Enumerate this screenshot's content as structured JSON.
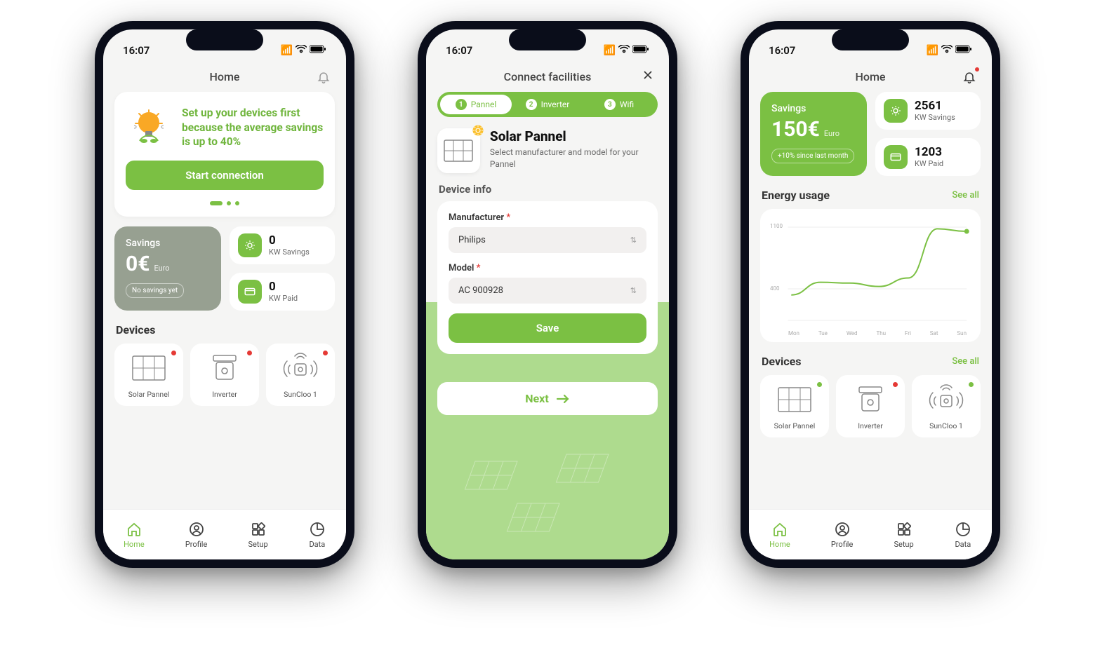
{
  "status": {
    "time": "16:07"
  },
  "screen1": {
    "header": "Home",
    "setup_text": "Set up your devices first because the average savings is up to 40%",
    "start_btn": "Start connection",
    "savings_label": "Savings",
    "savings_value": "0€",
    "savings_currency": "Euro",
    "savings_pill": "No savings yet",
    "kw_savings_num": "0",
    "kw_savings_lbl": "KW Savings",
    "kw_paid_num": "0",
    "kw_paid_lbl": "KW Paid",
    "devices_title": "Devices",
    "devices": [
      {
        "name": "Solar Pannel",
        "status": "red"
      },
      {
        "name": "Inverter",
        "status": "red"
      },
      {
        "name": "SunCloo 1",
        "status": "red"
      }
    ]
  },
  "screen2": {
    "header": "Connect facilities",
    "steps": [
      {
        "num": "1",
        "label": "Pannel",
        "active": true
      },
      {
        "num": "2",
        "label": "Inverter",
        "active": false
      },
      {
        "num": "3",
        "label": "Wifi",
        "active": false
      }
    ],
    "panel_title": "Solar Pannel",
    "panel_sub": "Select manufacturer and model for your Pannel",
    "device_info_title": "Device info",
    "manufacturer_label": "Manufacturer",
    "manufacturer_value": "Philips",
    "model_label": "Model",
    "model_value": "AC 900928",
    "save_btn": "Save",
    "next_btn": "Next"
  },
  "screen3": {
    "header": "Home",
    "savings_label": "Savings",
    "savings_value": "150€",
    "savings_currency": "Euro",
    "savings_pill": "+10% since last month",
    "kw_savings_num": "2561",
    "kw_savings_lbl": "KW Savings",
    "kw_paid_num": "1203",
    "kw_paid_lbl": "KW Paid",
    "energy_title": "Energy usage",
    "see_all": "See all",
    "devices_title": "Devices",
    "devices": [
      {
        "name": "Solar Pannel",
        "status": "green"
      },
      {
        "name": "Inverter",
        "status": "red"
      },
      {
        "name": "SunCloo 1",
        "status": "green"
      }
    ]
  },
  "nav": {
    "items": [
      {
        "label": "Home",
        "icon": "home"
      },
      {
        "label": "Profile",
        "icon": "profile"
      },
      {
        "label": "Setup",
        "icon": "setup"
      },
      {
        "label": "Data",
        "icon": "data"
      }
    ]
  },
  "chart_data": {
    "type": "line",
    "title": "Energy usage",
    "xlabel": "",
    "ylabel": "",
    "categories": [
      "Mon",
      "Tue",
      "Wed",
      "Thu",
      "Fri",
      "Sat",
      "Sun"
    ],
    "values": [
      300,
      450,
      440,
      400,
      500,
      1080,
      1050
    ],
    "ylim": [
      0,
      1100
    ],
    "yticks": [
      400,
      1100
    ]
  }
}
